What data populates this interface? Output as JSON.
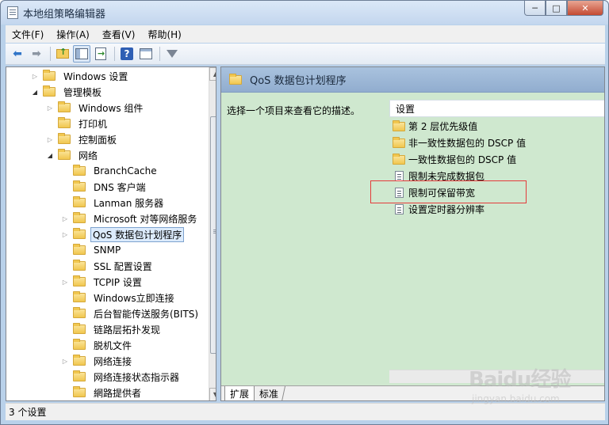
{
  "window": {
    "title": "本地组策略编辑器",
    "min_label": "─",
    "max_label": "□",
    "close_label": "✕"
  },
  "menu": [
    {
      "label": "文件(F)"
    },
    {
      "label": "操作(A)"
    },
    {
      "label": "查看(V)"
    },
    {
      "label": "帮助(H)"
    }
  ],
  "toolbar": {
    "buttons": [
      "back-icon",
      "forward-icon",
      "up-folder-icon",
      "show-tree-icon",
      "export-list-icon",
      "help-icon",
      "properties-icon",
      "filter-icon"
    ]
  },
  "tree": {
    "items": [
      {
        "label": "Windows 设置",
        "expander": "collapsed"
      },
      {
        "label": "管理模板",
        "expander": "expanded"
      },
      {
        "label": "Windows 组件",
        "expander": "collapsed"
      },
      {
        "label": "打印机",
        "expander": "none"
      },
      {
        "label": "控制面板",
        "expander": "collapsed"
      },
      {
        "label": "网络",
        "expander": "expanded"
      },
      {
        "label": "BranchCache",
        "expander": "none"
      },
      {
        "label": "DNS 客户端",
        "expander": "none"
      },
      {
        "label": "Lanman 服务器",
        "expander": "none"
      },
      {
        "label": "Microsoft 对等网络服务",
        "expander": "collapsed"
      },
      {
        "label": "QoS 数据包计划程序",
        "expander": "collapsed",
        "selected": true
      },
      {
        "label": "SNMP",
        "expander": "none"
      },
      {
        "label": "SSL 配置设置",
        "expander": "none"
      },
      {
        "label": "TCPIP 设置",
        "expander": "collapsed"
      },
      {
        "label": "Windows立即连接",
        "expander": "none"
      },
      {
        "label": "后台智能传送服务(BITS)",
        "expander": "none"
      },
      {
        "label": "链路层拓扑发现",
        "expander": "none"
      },
      {
        "label": "脱机文件",
        "expander": "none"
      },
      {
        "label": "网络连接",
        "expander": "collapsed"
      },
      {
        "label": "网络连接状态指示器",
        "expander": "none"
      },
      {
        "label": "網路提供者",
        "expander": "none"
      }
    ]
  },
  "right": {
    "header_title": "QoS 数据包计划程序",
    "description": "选择一个项目来查看它的描述。",
    "column_header": "设置",
    "rows": [
      {
        "label": "第 2 层优先级值",
        "kind": "folder"
      },
      {
        "label": "非一致性数据包的 DSCP 值",
        "kind": "folder"
      },
      {
        "label": "一致性数据包的 DSCP 值",
        "kind": "folder"
      },
      {
        "label": "限制未完成数据包",
        "kind": "setting"
      },
      {
        "label": "限制可保留带宽",
        "kind": "setting",
        "highlighted": true
      },
      {
        "label": "设置定时器分辨率",
        "kind": "setting"
      }
    ],
    "tabs": [
      {
        "label": "扩展",
        "active": true
      },
      {
        "label": "标准",
        "active": false
      }
    ]
  },
  "status": {
    "text": "3 个设置"
  },
  "watermark": {
    "logo": "Baidu经验",
    "sub": "jingyan.baidu.com"
  },
  "colors": {
    "right_pane_bg": "#cfe8cf",
    "header_bg": "#a9c2de",
    "highlight": "#e43a3a",
    "selection": "#dcebfc"
  }
}
